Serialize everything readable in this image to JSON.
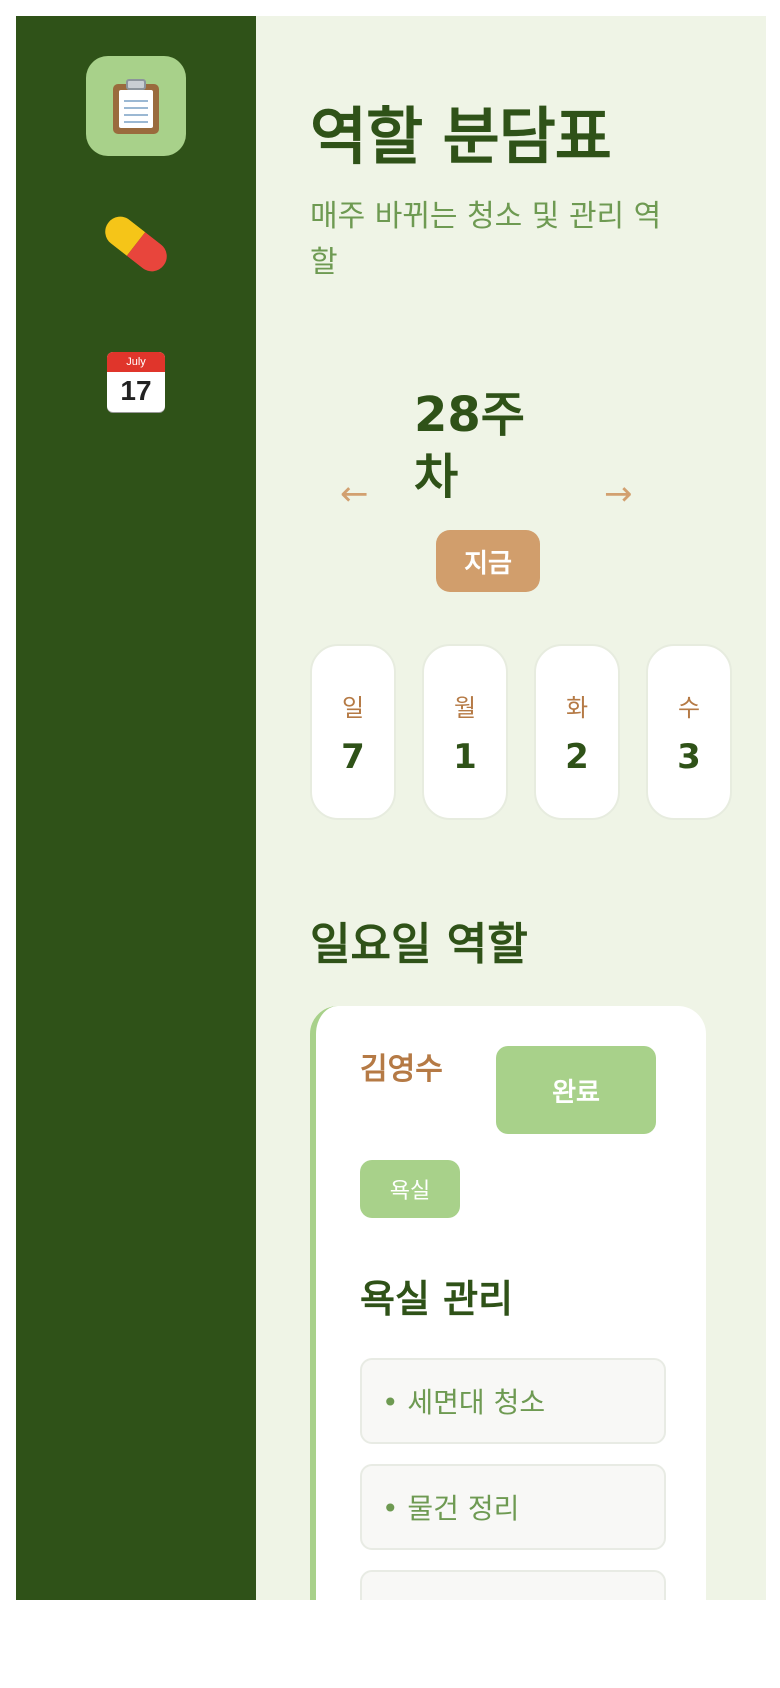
{
  "sidebar": {
    "items": [
      {
        "icon": "clipboard-icon",
        "active": true
      },
      {
        "icon": "pill-icon",
        "active": false
      },
      {
        "icon": "calendar-icon",
        "active": false,
        "calendar_month": "July",
        "calendar_day": "17"
      }
    ]
  },
  "header": {
    "title": "역할 분담표",
    "subtitle": "매주 바뀌는 청소 및 관리 역할"
  },
  "week": {
    "prev_arrow": "←",
    "next_arrow": "→",
    "label": "28주차",
    "now_badge": "지금"
  },
  "days": [
    {
      "name": "일",
      "date": "7"
    },
    {
      "name": "월",
      "date": "1"
    },
    {
      "name": "화",
      "date": "2"
    },
    {
      "name": "수",
      "date": "3"
    }
  ],
  "section": {
    "title": "일요일 역할"
  },
  "role_card": {
    "person": "김영수",
    "done_label": "완료",
    "tag": "욕실",
    "title": "욕실 관리",
    "tasks": [
      "• 세면대 청소",
      "• 물건 정리",
      ""
    ]
  },
  "colors": {
    "sidebar_bg": "#2f5218",
    "main_bg": "#eff4e6",
    "accent_green": "#a8d18a",
    "accent_brown": "#d19e6c",
    "text_dark_green": "#2f5218",
    "text_light_green": "#6e9a52"
  }
}
